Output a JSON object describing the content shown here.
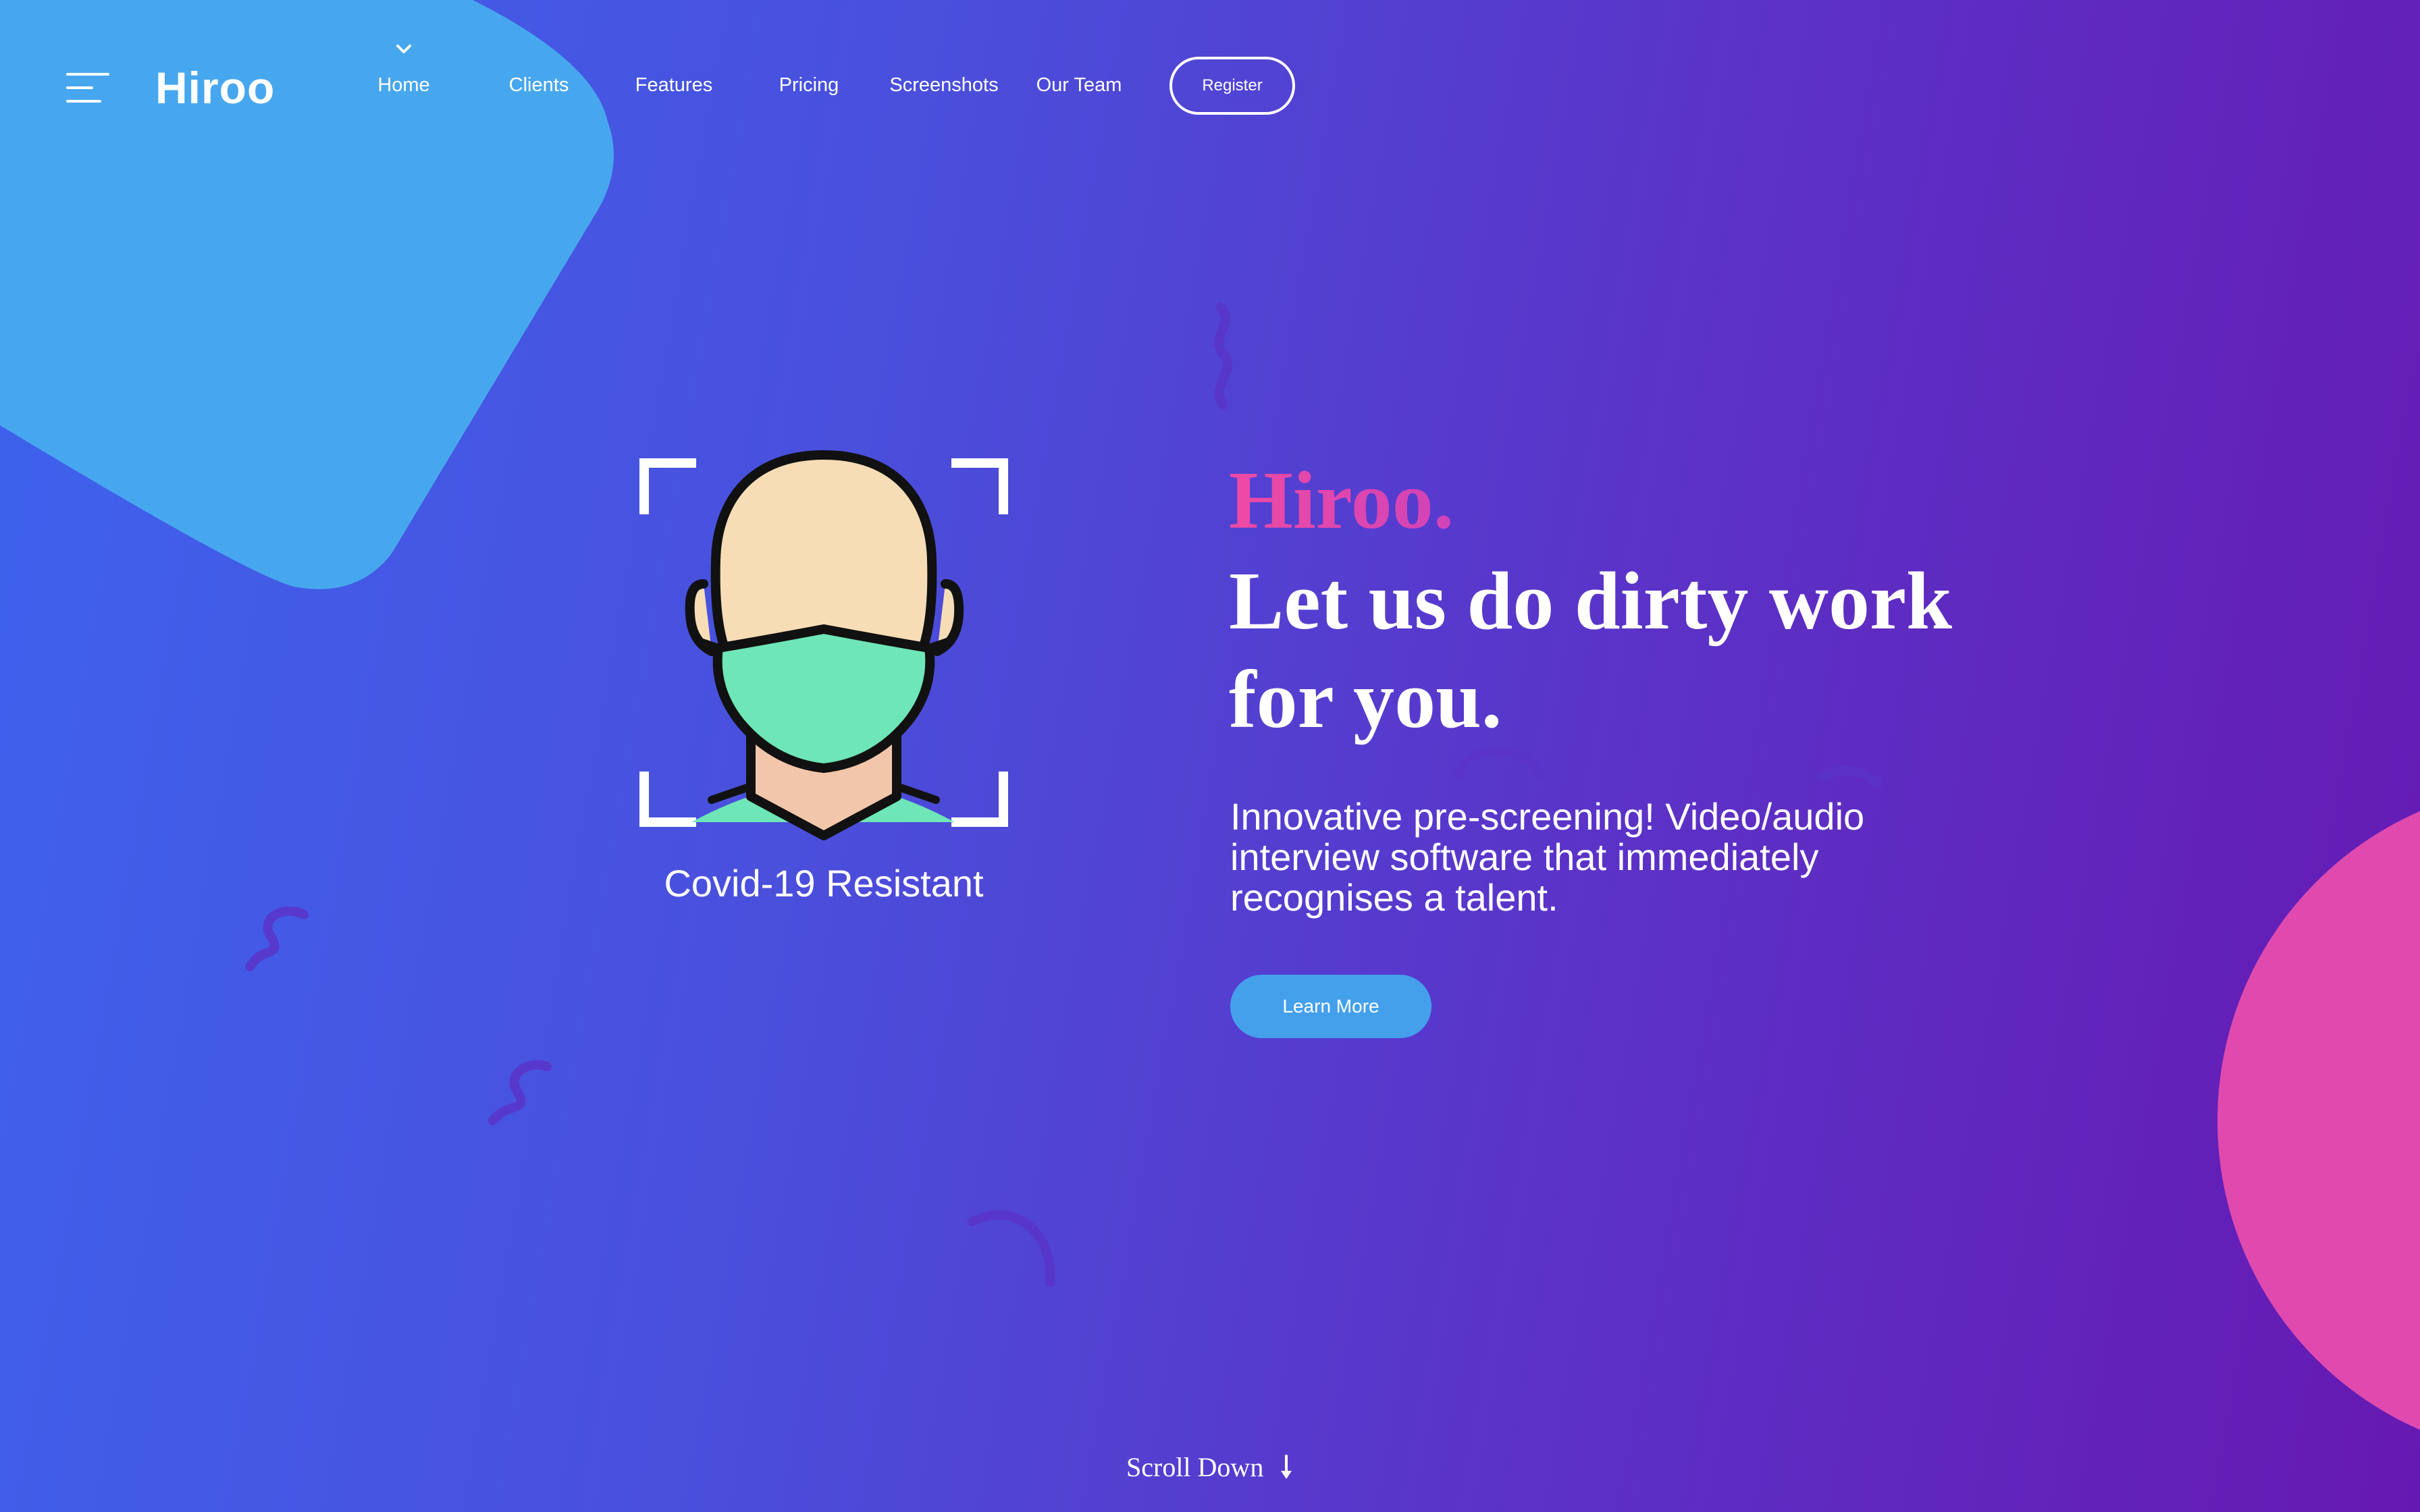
{
  "brand": {
    "logo": "Hiroo"
  },
  "nav": {
    "items": [
      {
        "label": "Home"
      },
      {
        "label": "Clients"
      },
      {
        "label": "Features"
      },
      {
        "label": "Pricing"
      },
      {
        "label": "Screenshots"
      },
      {
        "label": "Our Team"
      }
    ],
    "register_label": "Register"
  },
  "hero": {
    "illustration_caption": "Covid-19 Resistant",
    "brand_line": "Hiroo.",
    "heading_line1": "Let us do dirty work",
    "heading_line2": "for you.",
    "description": "Innovative pre-screening! Video/audio interview software that immediately recognises a talent.",
    "cta_label": "Learn More"
  },
  "footer": {
    "scroll_label": "Scroll Down"
  },
  "colors": {
    "background_start": "#3d63ee",
    "background_end": "#6619b2",
    "accent_blue": "#45a0ec",
    "accent_pink": "#e94aa8",
    "mask_green": "#6ee6b8",
    "skin": "#f6ddb6"
  },
  "icons": {
    "menu": "hamburger-menu-icon",
    "home_indicator": "chevron-down-icon",
    "illustration": "masked-face-scan-icon",
    "scroll": "arrow-down-icon"
  }
}
